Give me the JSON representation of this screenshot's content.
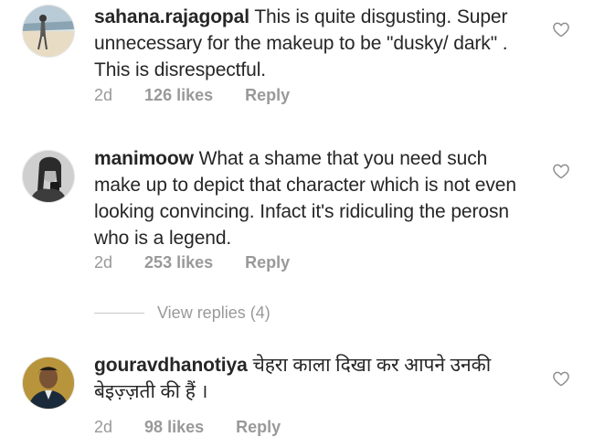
{
  "comments": [
    {
      "username": "sahana.rajagopal",
      "text": "This is quite disgusting. Super unnecessary for the makeup to be \"dusky/ dark\" . This is disrespectful.",
      "time": "2d",
      "likes": "126 likes",
      "reply_label": "Reply"
    },
    {
      "username": "manimoow",
      "text": "What a shame that you need such make up to depict that character which is not even looking convincing. Infact it's ridiculing the perosn who is a legend.",
      "time": "2d",
      "likes": "253 likes",
      "reply_label": "Reply",
      "view_replies": "View replies (4)"
    },
    {
      "username": "gouravdhanotiya",
      "text": "चेहरा काला दिखा कर आपने उनकी बेइज़्ज़ती की हैं ।",
      "time": "2d",
      "likes": "98 likes",
      "reply_label": "Reply"
    }
  ],
  "icons": {
    "like": "heart-outline-icon"
  },
  "colors": {
    "text": "#262626",
    "secondary": "#999999",
    "divider": "#c7c7c7"
  }
}
